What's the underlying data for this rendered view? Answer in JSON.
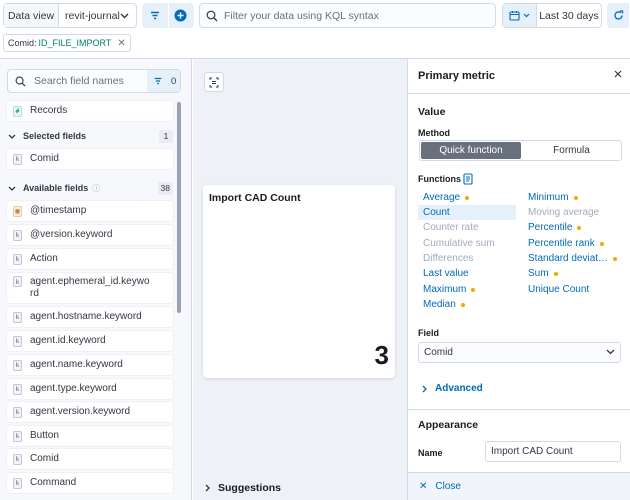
{
  "topbar": {
    "data_view_label": "Data view",
    "data_view_value": "revit-journal",
    "kql_placeholder": "Filter your data using KQL syntax",
    "date_range": "Last 30 days"
  },
  "filter_pill": {
    "key": "Comid:",
    "value": "ID_FILE_IMPORT"
  },
  "left_panel": {
    "search_placeholder": "Search field names",
    "filter_count": "0",
    "records_label": "Records",
    "selected_fields": {
      "label": "Selected fields",
      "count": "1",
      "items": [
        "Comid"
      ]
    },
    "available_fields": {
      "label": "Available fields",
      "count": "38",
      "items": [
        "@timestamp",
        "@version.keyword",
        "Action",
        "agent.ephemeral_id.keyword",
        "agent.hostname.keyword",
        "agent.id.keyword",
        "agent.name.keyword",
        "agent.type.keyword",
        "agent.version.keyword",
        "Button",
        "Comid",
        "Command"
      ]
    }
  },
  "workspace": {
    "card_title": "Import CAD Count",
    "card_value": "3",
    "suggestions_label": "Suggestions"
  },
  "right_panel": {
    "title": "Primary metric",
    "value_heading": "Value",
    "method_label": "Method",
    "method_options": [
      "Quick function",
      "Formula"
    ],
    "functions_label": "Functions",
    "functions_left": [
      "Average",
      "Count",
      "Counter rate",
      "Cumulative sum",
      "Differences",
      "Last value",
      "Maximum",
      "Median"
    ],
    "functions_right": [
      "Minimum",
      "Moving average",
      "Percentile",
      "Percentile rank",
      "Standard deviat…",
      "Sum",
      "Unique Count"
    ],
    "field_label": "Field",
    "field_value": "Comid",
    "advanced_label": "Advanced",
    "appearance_heading": "Appearance",
    "name_label": "Name",
    "name_value": "Import CAD Count",
    "close_label": "Close"
  },
  "colors": {
    "accent": "#006bb8",
    "warning_dot": "#f5a700",
    "value_green": "#017d73"
  }
}
